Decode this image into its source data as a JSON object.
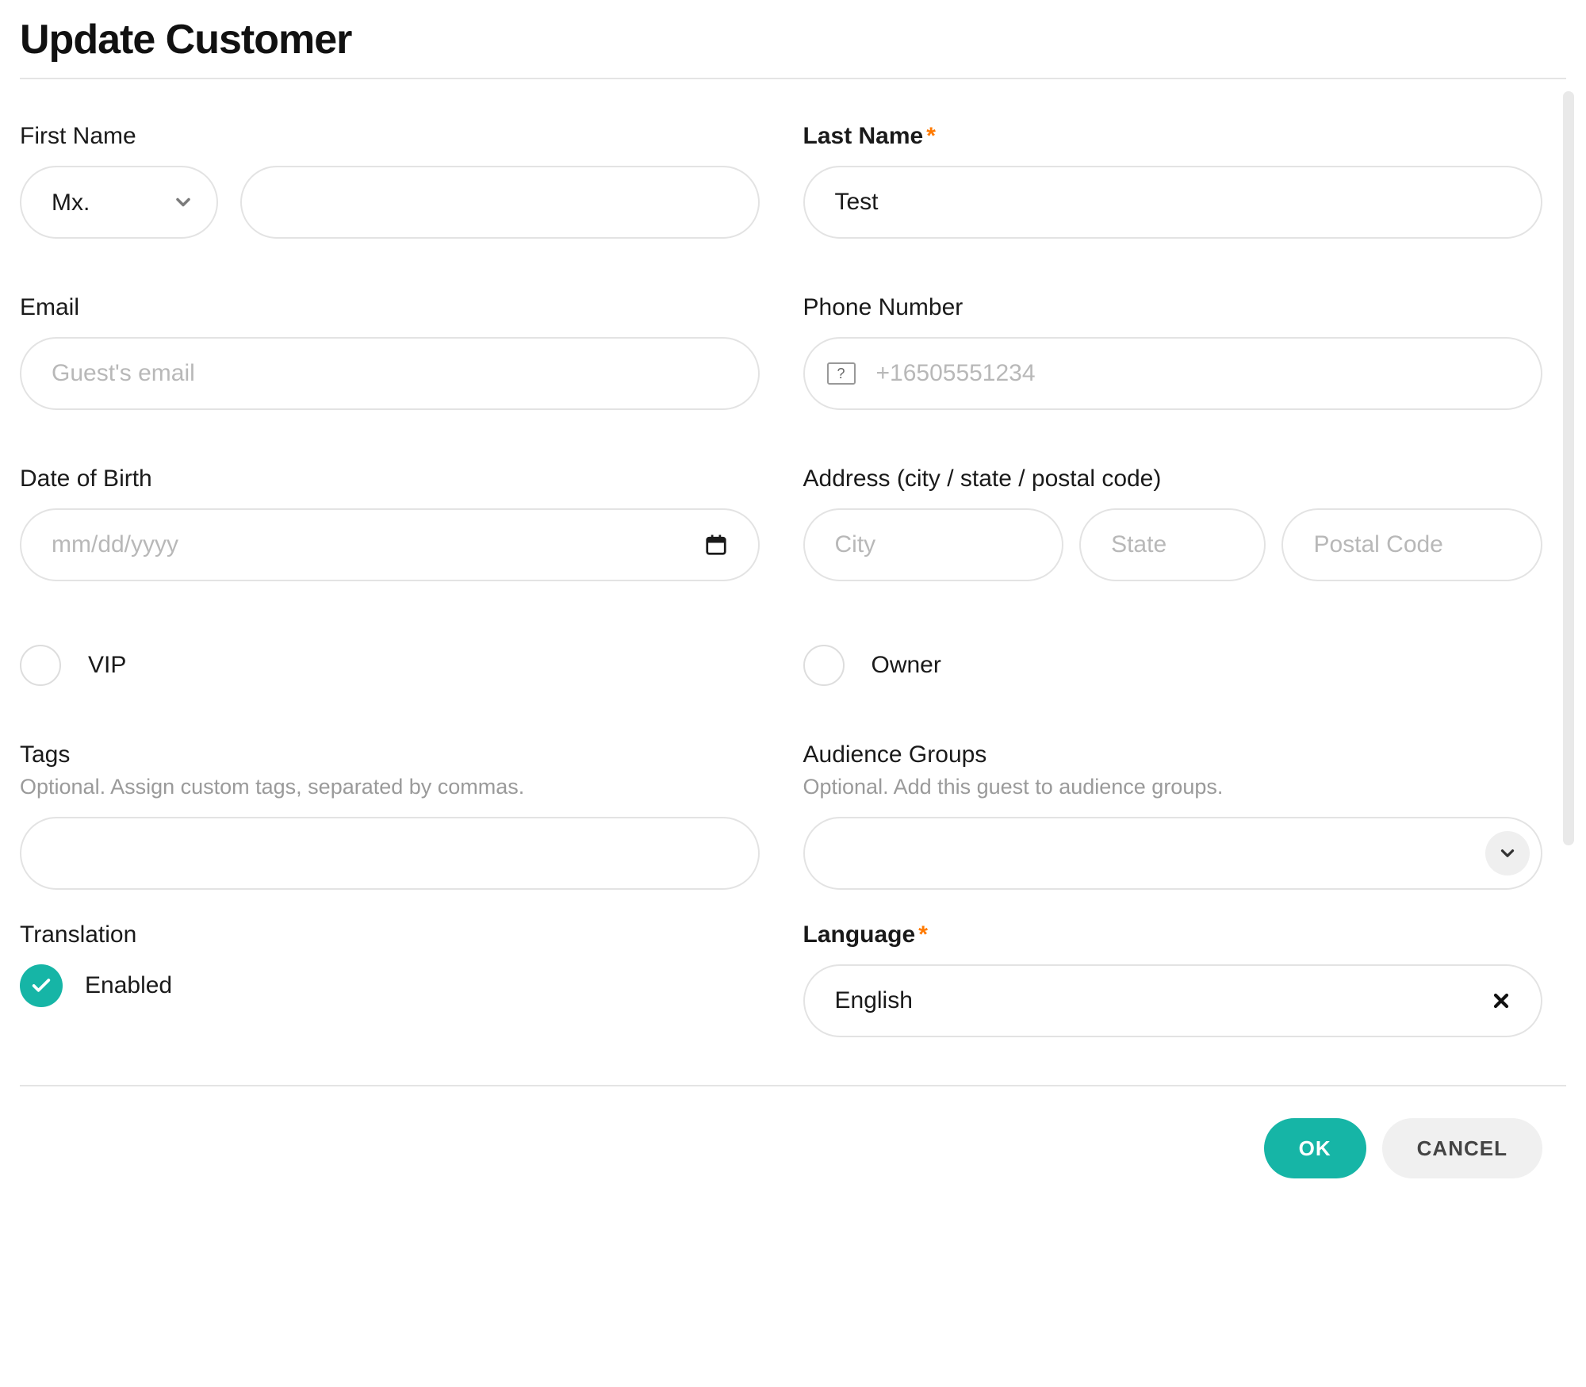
{
  "title": "Update Customer",
  "form": {
    "first_name": {
      "label": "First Name",
      "value": ""
    },
    "title_select": {
      "value": "Mx."
    },
    "last_name": {
      "label": "Last Name",
      "required": true,
      "value": "Test"
    },
    "email": {
      "label": "Email",
      "placeholder": "Guest's email",
      "value": ""
    },
    "phone": {
      "label": "Phone Number",
      "placeholder": "+16505551234",
      "value": "",
      "intl_indicator": "?"
    },
    "dob": {
      "label": "Date of Birth",
      "placeholder": "mm/dd/yyyy",
      "value": ""
    },
    "address": {
      "label": "Address (city / state / postal code)",
      "city_placeholder": "City",
      "state_placeholder": "State",
      "postal_placeholder": "Postal Code"
    },
    "vip": {
      "label": "VIP",
      "checked": false
    },
    "owner": {
      "label": "Owner",
      "checked": false
    },
    "tags": {
      "label": "Tags",
      "help": "Optional. Assign custom tags, separated by commas.",
      "value": ""
    },
    "audience": {
      "label": "Audience Groups",
      "help": "Optional. Add this guest to audience groups.",
      "value": ""
    },
    "translation": {
      "label": "Translation",
      "status_label": "Enabled",
      "enabled": true
    },
    "language": {
      "label": "Language",
      "required": true,
      "value": "English"
    }
  },
  "actions": {
    "ok": "OK",
    "cancel": "CANCEL"
  },
  "colors": {
    "accent": "#16b5a6",
    "required": "#ff7a00"
  }
}
